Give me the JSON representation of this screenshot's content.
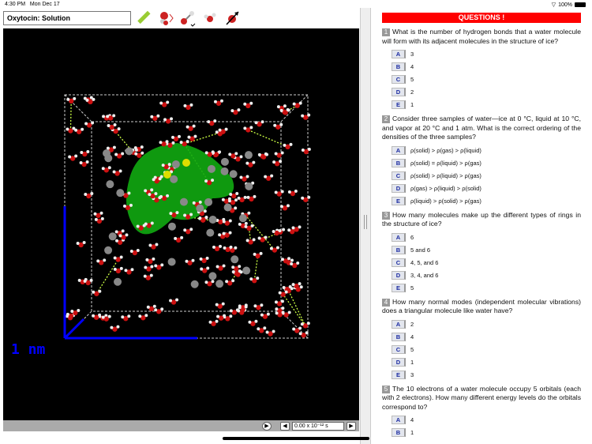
{
  "status": {
    "time": "4:30 PM",
    "date": "Mon Dec 17",
    "battery": "100%"
  },
  "title": "Oxytocin: Solution",
  "tools": [
    "ruler-icon",
    "rotate-molecule-icon",
    "bond-icon",
    "water-molecule-icon",
    "dipole-icon"
  ],
  "scale_label": "1 nm",
  "time_display": "0.00 x 10⁻¹² s",
  "colors": {
    "header": "#ff0000",
    "axis": "#0000ff",
    "hbond": "#ccff44",
    "surface": "#11aa11"
  },
  "questions_header": "QUESTIONS !",
  "questions": [
    {
      "num": "1",
      "text": "What is the number of hydrogen bonds that a water molecule will form with its adjacent molecules in the structure of ice?",
      "options": [
        {
          "l": "A",
          "t": "3"
        },
        {
          "l": "B",
          "t": "4"
        },
        {
          "l": "C",
          "t": "5"
        },
        {
          "l": "D",
          "t": "2"
        },
        {
          "l": "E",
          "t": "1"
        }
      ]
    },
    {
      "num": "2",
      "text": "Consider three samples of water—ice at 0 °C, liquid at 10 °C, and vapor at 20 °C and 1 atm. What is the correct ordering of the densities of the three samples?",
      "options": [
        {
          "l": "A",
          "t": "ρ(solid) > ρ(gas) > ρ(liquid)"
        },
        {
          "l": "B",
          "t": "ρ(solid) = ρ(liquid) > ρ(gas)"
        },
        {
          "l": "C",
          "t": "ρ(solid) > ρ(liquid) > ρ(gas)"
        },
        {
          "l": "D",
          "t": "ρ(gas) > ρ(liquid) > ρ(solid)"
        },
        {
          "l": "E",
          "t": "ρ(liquid) > ρ(solid) > ρ(gas)"
        }
      ]
    },
    {
      "num": "3",
      "text": "How many molecules make up the different types of rings in the structure of ice?",
      "options": [
        {
          "l": "A",
          "t": "6"
        },
        {
          "l": "B",
          "t": "5 and 6"
        },
        {
          "l": "C",
          "t": "4, 5, and 6"
        },
        {
          "l": "D",
          "t": "3, 4, and 6"
        },
        {
          "l": "E",
          "t": "5"
        }
      ]
    },
    {
      "num": "4",
      "text": "How many normal modes (independent molecular vibrations) does a triangular molecule like water have?",
      "options": [
        {
          "l": "A",
          "t": "2"
        },
        {
          "l": "B",
          "t": "4"
        },
        {
          "l": "C",
          "t": "5"
        },
        {
          "l": "D",
          "t": "1"
        },
        {
          "l": "E",
          "t": "3"
        }
      ]
    },
    {
      "num": "5",
      "text": "The 10 electrons of a water molecule occupy 5 orbitals (each with 2 electrons). How many different energy levels do the orbitals correspond to?",
      "options": [
        {
          "l": "A",
          "t": "4"
        },
        {
          "l": "B",
          "t": "1"
        }
      ]
    }
  ]
}
